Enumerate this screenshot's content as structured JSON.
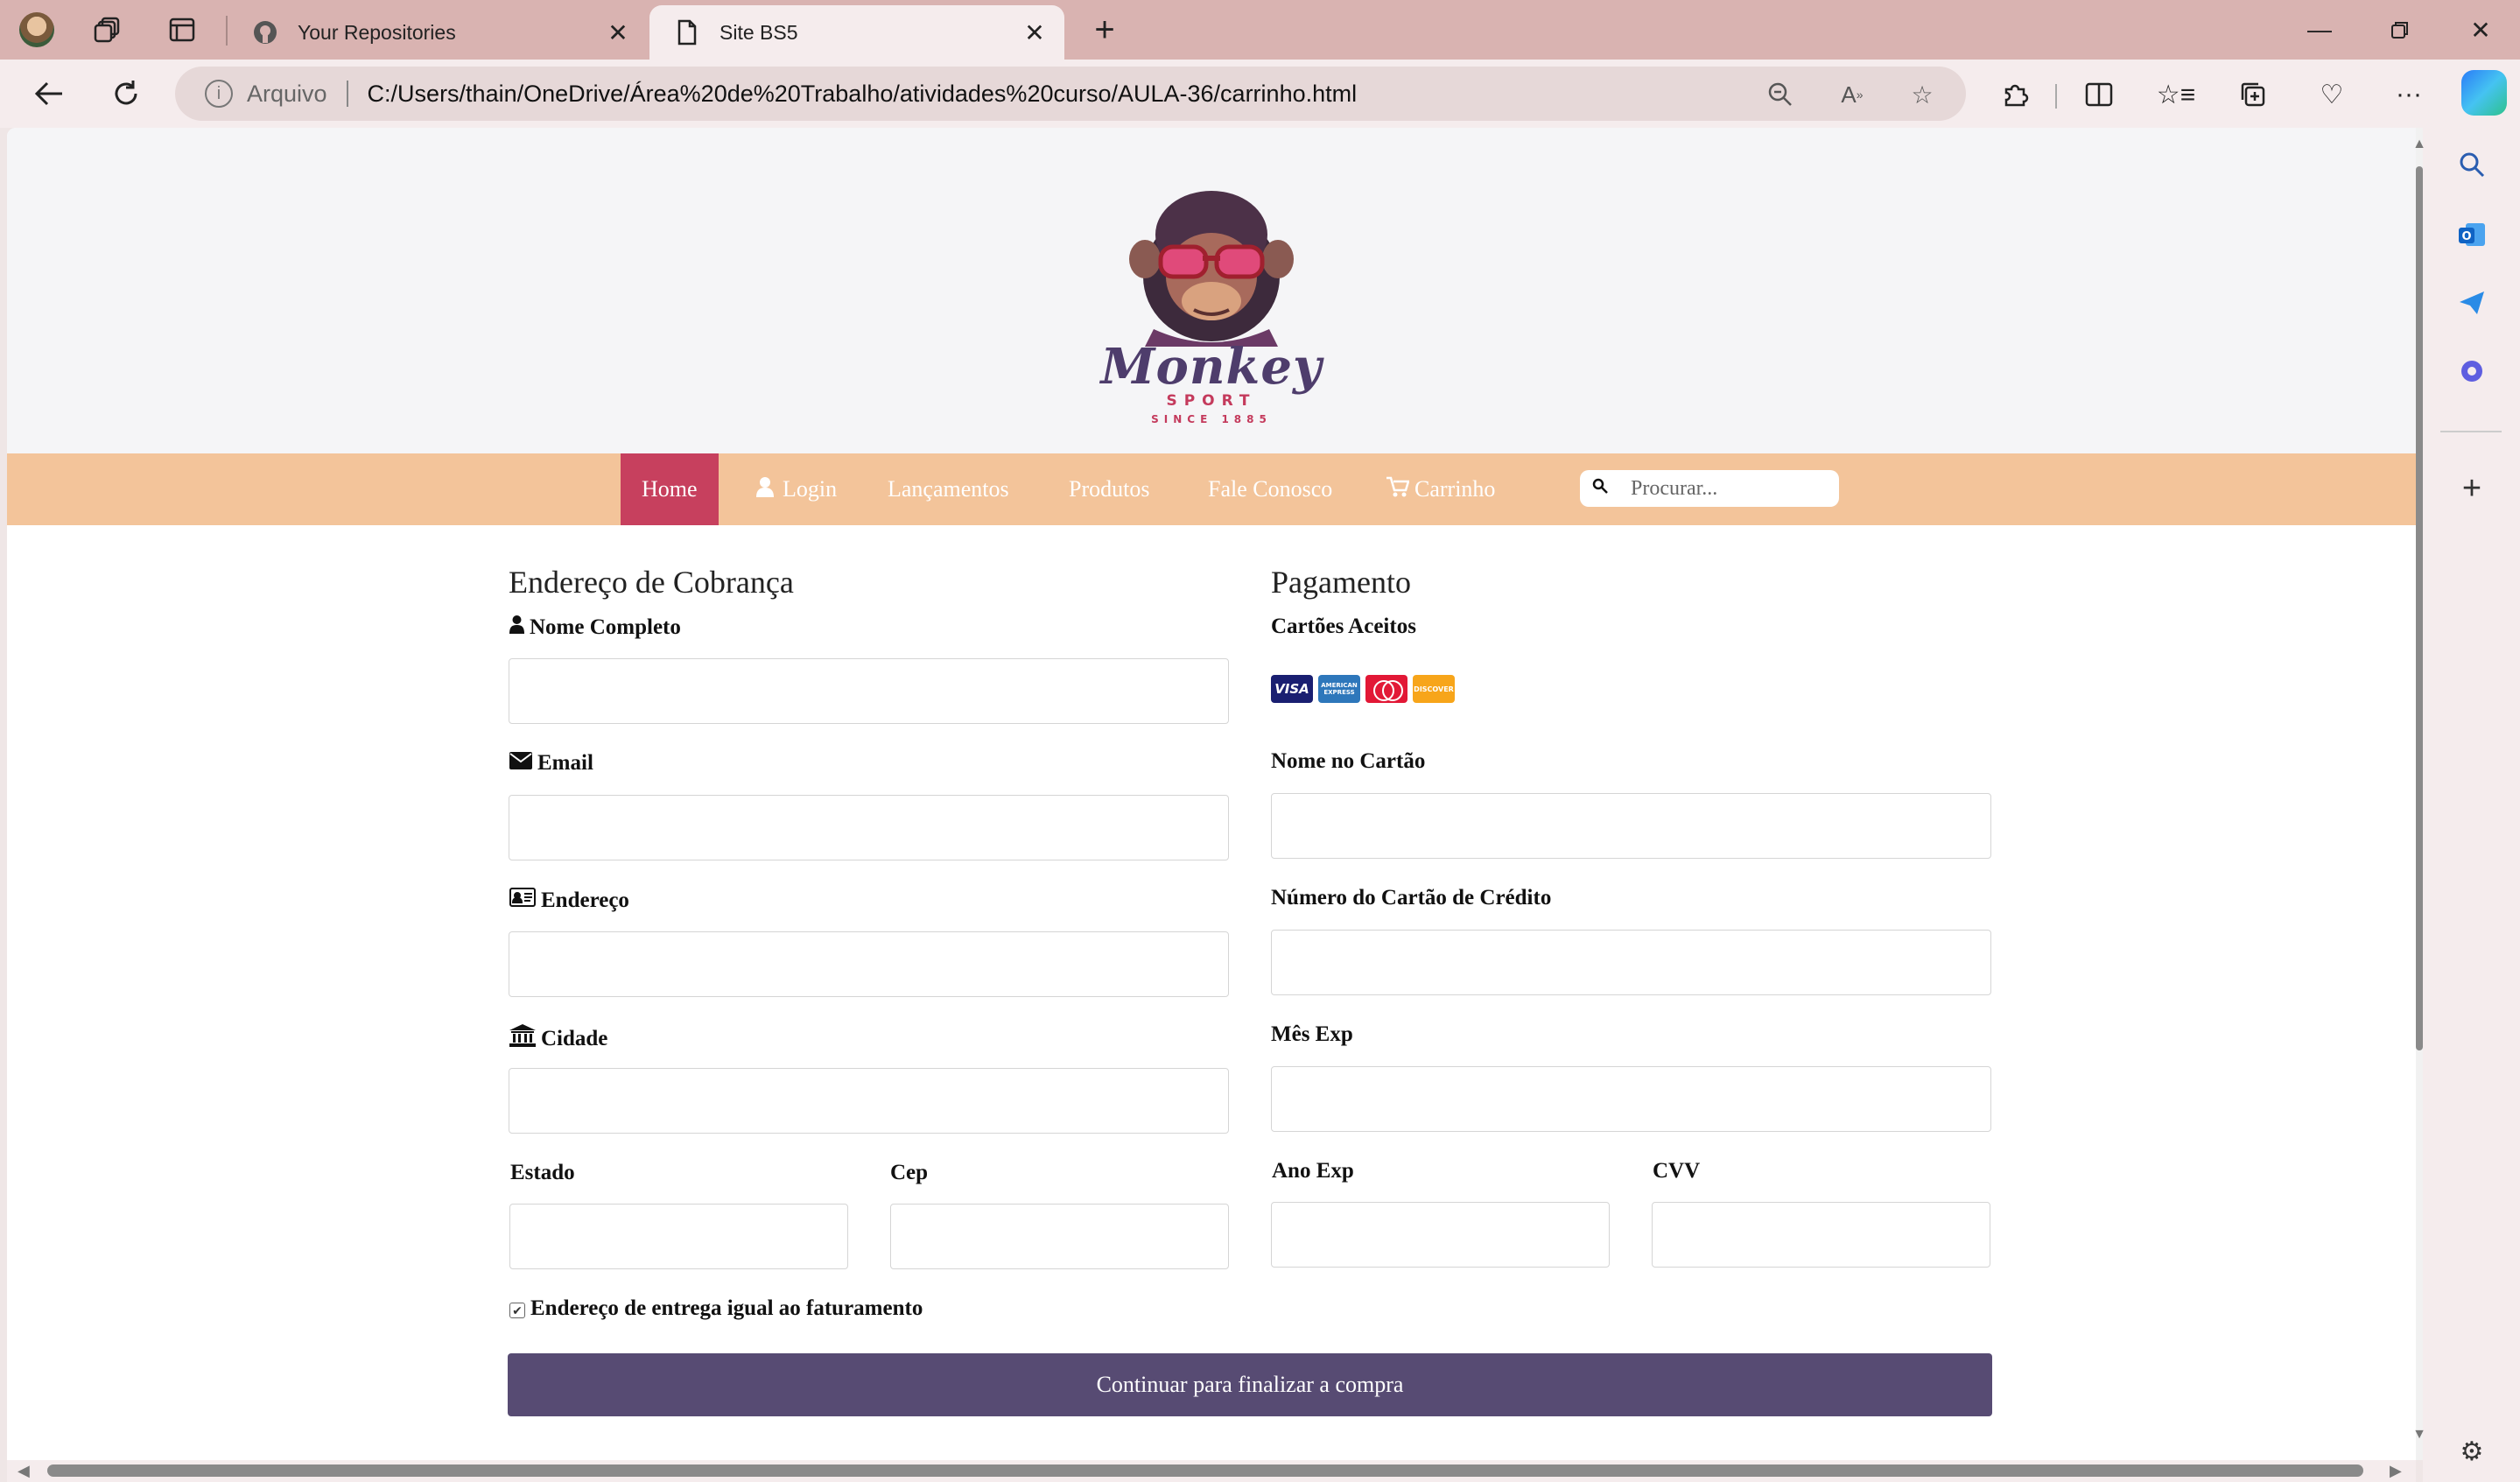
{
  "browser": {
    "tabs": [
      {
        "title": "Your Repositories",
        "favicon": "github-icon",
        "active": false
      },
      {
        "title": "Site BS5",
        "favicon": "page-icon",
        "active": true
      }
    ],
    "address": {
      "security_label": "Arquivo",
      "url": "C:/Users/thain/OneDrive/Área%20de%20Trabalho/atividades%20curso/AULA-36/carrinho.html"
    }
  },
  "site": {
    "logo": {
      "name": "Monkey",
      "sub": "SPORT",
      "since": "SINCE 1885"
    },
    "nav": {
      "home": "Home",
      "login": "Login",
      "lancamentos": "Lançamentos",
      "produtos": "Produtos",
      "fale_conosco": "Fale Conosco",
      "carrinho": "Carrinho"
    },
    "search_placeholder": "Procurar..."
  },
  "billing": {
    "title": "Endereço de Cobrança",
    "nome_label": "Nome Completo",
    "email_label": "Email",
    "endereco_label": "Endereço",
    "cidade_label": "Cidade",
    "estado_label": "Estado",
    "cep_label": "Cep"
  },
  "payment": {
    "title": "Pagamento",
    "cards_label": "Cartões Aceitos",
    "cards": [
      "VISA",
      "AMERICAN EXPRESS",
      "mastercard",
      "DISCOVER"
    ],
    "nome_cartao_label": "Nome no Cartão",
    "numero_label": "Número do Cartão de Crédito",
    "mes_label": "Mês Exp",
    "ano_label": "Ano Exp",
    "cvv_label": "CVV"
  },
  "same_address": {
    "label": "Endereço de entrega igual ao faturamento",
    "checked": true
  },
  "submit_label": "Continuar para finalizar a compra",
  "colors": {
    "navbar": "#f3c49a",
    "nav_active": "#c7405e",
    "button": "#574b73",
    "tabbar": "#d9b3b1"
  }
}
